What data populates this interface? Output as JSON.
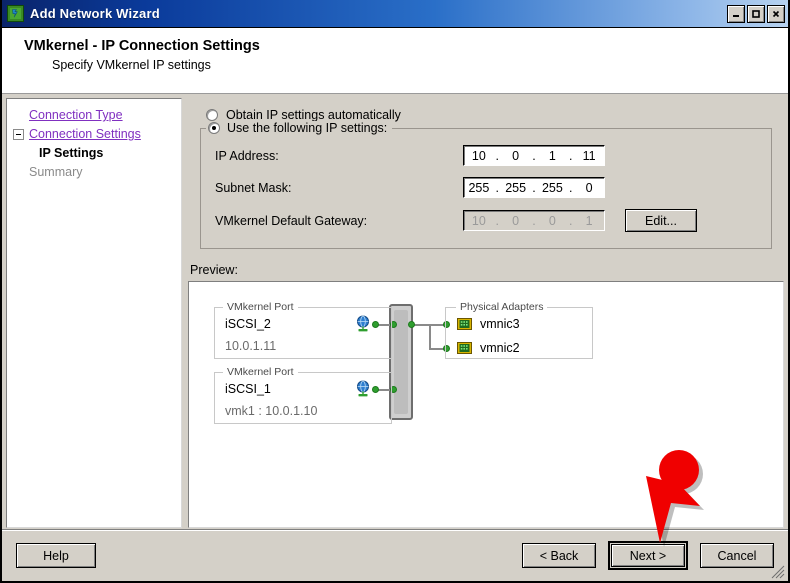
{
  "window": {
    "title": "Add Network Wizard",
    "icon": "network-wizard-icon",
    "minimize_label": "Minimize",
    "maximize_label": "Maximize",
    "close_label": "Close"
  },
  "header": {
    "title": "VMkernel - IP Connection Settings",
    "subtitle": "Specify VMkernel IP settings"
  },
  "sidebar": {
    "items": [
      {
        "label": "Connection Type",
        "state": "link"
      },
      {
        "label": "Connection Settings",
        "state": "link-expandable"
      },
      {
        "label": "IP Settings",
        "state": "current"
      },
      {
        "label": "Summary",
        "state": "future"
      }
    ]
  },
  "ip_settings": {
    "option_auto": "Obtain IP settings automatically",
    "option_manual": "Use the following IP settings:",
    "selected_option": "manual",
    "fields": [
      {
        "label": "IP Address:",
        "octets": [
          "10",
          "0",
          "1",
          "11"
        ],
        "disabled": false
      },
      {
        "label": "Subnet Mask:",
        "octets": [
          "255",
          "255",
          "255",
          "0"
        ],
        "disabled": false
      },
      {
        "label": "VMkernel Default Gateway:",
        "octets": [
          "10",
          "0",
          "0",
          "1"
        ],
        "disabled": true
      }
    ],
    "edit_button": "Edit..."
  },
  "preview": {
    "label": "Preview:",
    "vmkernel_ports": [
      {
        "legend": "VMkernel Port",
        "name": "iSCSI_2",
        "ip": "10.0.1.11"
      },
      {
        "legend": "VMkernel Port",
        "name": "iSCSI_1",
        "ip": "vmk1 : 10.0.1.10"
      }
    ],
    "physical_adapters": {
      "legend": "Physical Adapters",
      "nics": [
        "vmnic3",
        "vmnic2"
      ]
    }
  },
  "footer": {
    "help": "Help",
    "back": "< Back",
    "next": "Next >",
    "cancel": "Cancel",
    "focused_button": "Next >"
  },
  "annotation": {
    "type": "red-arrow",
    "color": "#f00000",
    "points_to": "Next >"
  }
}
